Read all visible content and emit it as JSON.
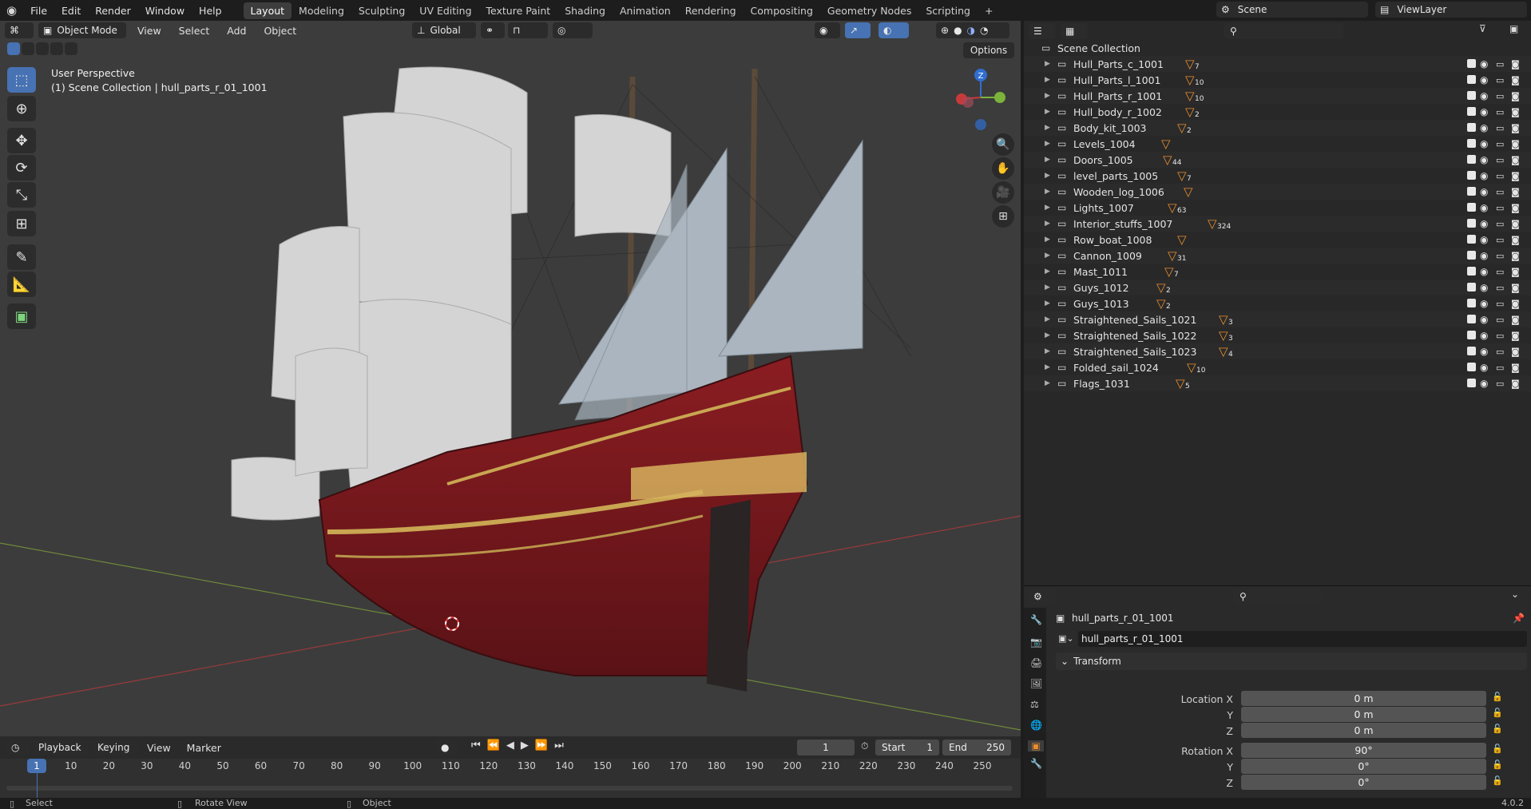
{
  "topbar": {
    "menus": [
      "File",
      "Edit",
      "Render",
      "Window",
      "Help"
    ],
    "workspaces": [
      "Layout",
      "Modeling",
      "Sculpting",
      "UV Editing",
      "Texture Paint",
      "Shading",
      "Animation",
      "Rendering",
      "Compositing",
      "Geometry Nodes",
      "Scripting"
    ],
    "active_workspace": "Layout",
    "add_tab": "+",
    "scene": "Scene",
    "view_layer": "ViewLayer"
  },
  "viewport": {
    "mode": "Object Mode",
    "menus": [
      "View",
      "Select",
      "Add",
      "Object"
    ],
    "orientation": "Global",
    "options": "Options",
    "info_title": "User Perspective",
    "info_object": "(1) Scene Collection | hull_parts_r_01_1001",
    "gizmo_z": "Z"
  },
  "outliner": {
    "root": "Scene Collection",
    "items": [
      {
        "name": "Hull_Parts_c_1001",
        "count": "7"
      },
      {
        "name": "Hull_Parts_l_1001",
        "count": "10"
      },
      {
        "name": "Hull_Parts_r_1001",
        "count": "10"
      },
      {
        "name": "Hull_body_r_1002",
        "count": "2"
      },
      {
        "name": "Body_kit_1003",
        "count": "2"
      },
      {
        "name": "Levels_1004",
        "count": ""
      },
      {
        "name": "Doors_1005",
        "count": "44"
      },
      {
        "name": "level_parts_1005",
        "count": "7"
      },
      {
        "name": "Wooden_log_1006",
        "count": ""
      },
      {
        "name": "Lights_1007",
        "count": "63"
      },
      {
        "name": "Interior_stuffs_1007",
        "count": "324"
      },
      {
        "name": "Row_boat_1008",
        "count": ""
      },
      {
        "name": "Cannon_1009",
        "count": "31"
      },
      {
        "name": "Mast_1011",
        "count": "7"
      },
      {
        "name": "Guys_1012",
        "count": "2"
      },
      {
        "name": "Guys_1013",
        "count": "2"
      },
      {
        "name": "Straightened_Sails_1021",
        "count": "3"
      },
      {
        "name": "Straightened_Sails_1022",
        "count": "3"
      },
      {
        "name": "Straightened_Sails_1023",
        "count": "4"
      },
      {
        "name": "Folded_sail_1024",
        "count": "10"
      },
      {
        "name": "Flags_1031",
        "count": "5"
      }
    ]
  },
  "properties": {
    "object_title": "hull_parts_r_01_1001",
    "object_name": "hull_parts_r_01_1001",
    "panel": "Transform",
    "location_label": "Location X",
    "rotation_label": "Rotation X",
    "y": "Y",
    "z": "Z",
    "loc_x": "0 m",
    "loc_y": "0 m",
    "loc_z": "0 m",
    "rot_x": "90°",
    "rot_y": "0°",
    "rot_z": "0°"
  },
  "timeline": {
    "menus": [
      "Playback",
      "Keying",
      "View",
      "Marker"
    ],
    "current_frame": "1",
    "start_label": "Start",
    "start": "1",
    "end_label": "End",
    "end": "250",
    "ticks": [
      "1",
      "10",
      "20",
      "30",
      "40",
      "50",
      "60",
      "70",
      "80",
      "90",
      "100",
      "110",
      "120",
      "130",
      "140",
      "150",
      "160",
      "170",
      "180",
      "190",
      "200",
      "210",
      "220",
      "230",
      "240",
      "250"
    ]
  },
  "status": {
    "select": "Select",
    "rotate": "Rotate View",
    "object": "Object",
    "version": "4.0.2"
  },
  "colors": {
    "accent": "#4772b3",
    "orange": "#e98d2f",
    "bg": "#3c3c3c"
  }
}
